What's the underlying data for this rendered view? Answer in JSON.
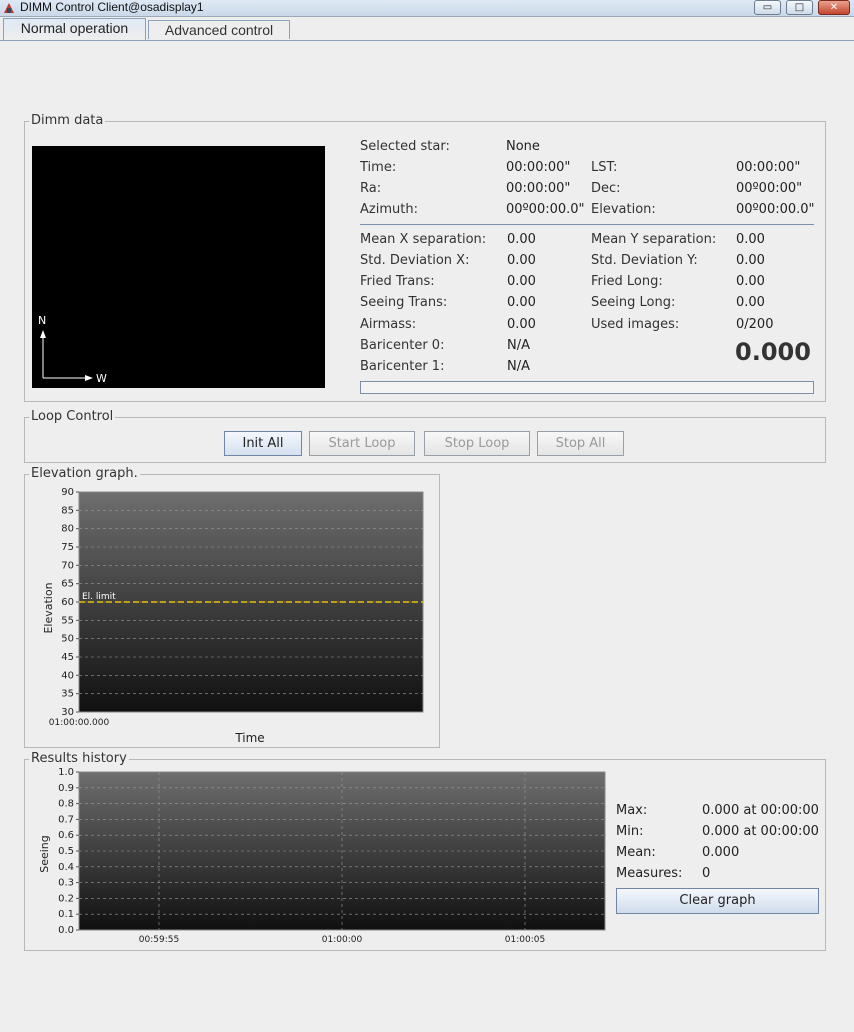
{
  "window": {
    "title": "DIMM Control Client@osadisplay1",
    "minimize_label": "▭",
    "maximize_label": "□",
    "close_label": "✕"
  },
  "tabs": [
    {
      "label": "Normal operation",
      "active": true
    },
    {
      "label": "Advanced control",
      "active": false
    }
  ],
  "dimm_data": {
    "title": "Dimm data",
    "camera": {
      "north_label": "N",
      "west_label": "W"
    },
    "fields": {
      "selected_star": {
        "label": "Selected star:",
        "value": "None"
      },
      "time": {
        "label": "Time:",
        "value": "00:00:00\""
      },
      "lst": {
        "label": "LST:",
        "value": "00:00:00\""
      },
      "ra": {
        "label": "Ra:",
        "value": "00:00:00\""
      },
      "dec": {
        "label": "Dec:",
        "value": "00º00:00\""
      },
      "azimuth": {
        "label": "Azimuth:",
        "value": "00º00:00.0\""
      },
      "elevation": {
        "label": "Elevation:",
        "value": "00º00:00.0\""
      },
      "mean_x_sep": {
        "label": "Mean X separation:",
        "value": "0.00"
      },
      "mean_y_sep": {
        "label": "Mean Y separation:",
        "value": "0.00"
      },
      "std_dev_x": {
        "label": "Std. Deviation X:",
        "value": "0.00"
      },
      "std_dev_y": {
        "label": "Std. Deviation Y:",
        "value": "0.00"
      },
      "fried_trans": {
        "label": "Fried Trans:",
        "value": "0.00"
      },
      "fried_long": {
        "label": "Fried Long:",
        "value": "0.00"
      },
      "seeing_trans": {
        "label": "Seeing Trans:",
        "value": "0.00"
      },
      "seeing_long": {
        "label": "Seeing Long:",
        "value": "0.00"
      },
      "airmass": {
        "label": "Airmass:",
        "value": "0.00"
      },
      "used_images": {
        "label": "Used images:",
        "value": "0/200"
      },
      "baricenter0": {
        "label": "Baricenter 0:",
        "value": "N/A"
      },
      "baricenter1": {
        "label": "Baricenter 1:",
        "value": "N/A"
      }
    },
    "seeing_big": "0.000",
    "progress": 0
  },
  "loop_control": {
    "title": "Loop Control",
    "buttons": [
      {
        "label": "Init All",
        "enabled": true
      },
      {
        "label": "Start Loop",
        "enabled": false
      },
      {
        "label": "Stop Loop",
        "enabled": false
      },
      {
        "label": "Stop All",
        "enabled": false
      }
    ]
  },
  "elevation_graph": {
    "title": "Elevation graph.",
    "limit_label": "El. limit",
    "colors": {
      "plot_top": "#6e6e6e",
      "plot_bottom": "#101010",
      "limit_line": "#e8c000",
      "grid": "#9a9a9a"
    }
  },
  "results_history": {
    "title": "Results history",
    "stats": {
      "max": {
        "label": "Max:",
        "value": "0.000 at 00:00:00"
      },
      "min": {
        "label": "Min:",
        "value": "0.000 at 00:00:00"
      },
      "mean": {
        "label": "Mean:",
        "value": "0.000"
      },
      "measures": {
        "label": "Measures:",
        "value": "0"
      }
    },
    "clear_button": "Clear graph"
  },
  "chart_data": [
    {
      "type": "line",
      "xlabel": "Time",
      "ylabel": "Elevation",
      "ylim": [
        30,
        90
      ],
      "yticks": [
        30,
        35,
        40,
        45,
        50,
        55,
        60,
        65,
        70,
        75,
        80,
        85,
        90
      ],
      "xticks": [
        "01:00:00.000"
      ],
      "grid": true,
      "series": [],
      "annotations": [
        {
          "text": "El. limit",
          "y": 60
        }
      ]
    },
    {
      "type": "line",
      "xlabel": "",
      "ylabel": "Seeing",
      "ylim": [
        0.0,
        1.0
      ],
      "yticks": [
        "0.0",
        "0.1",
        "0.2",
        "0.3",
        "0.4",
        "0.5",
        "0.6",
        "0.7",
        "0.8",
        "0.9",
        "1.0"
      ],
      "xticks": [
        "00:59:55",
        "01:00:00",
        "01:00:05"
      ],
      "grid": true,
      "series": []
    }
  ]
}
